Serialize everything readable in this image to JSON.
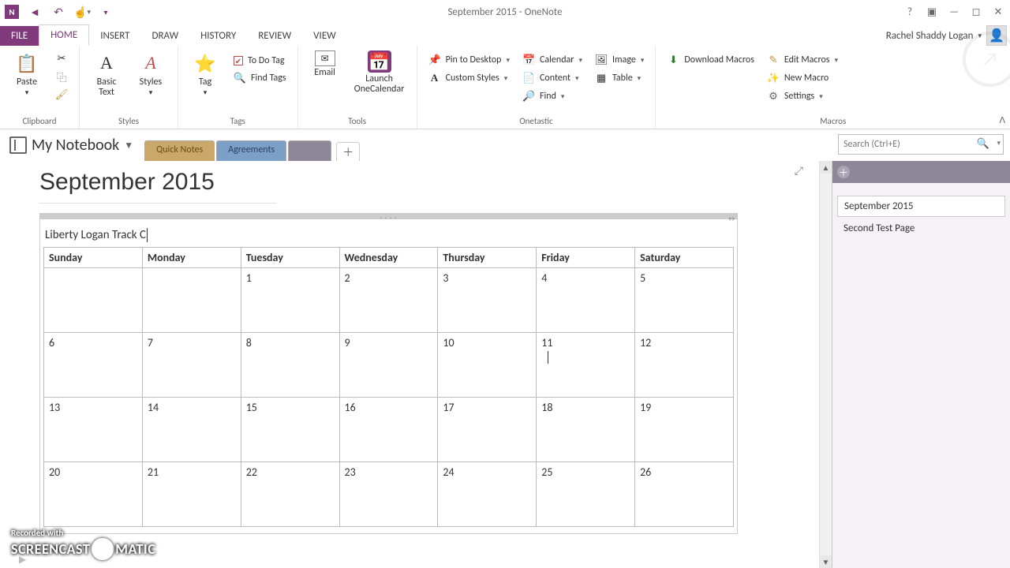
{
  "titlebar": {
    "title": "September 2015 - OneNote"
  },
  "file_tab": "FILE",
  "tabs": {
    "home": "HOME",
    "insert": "INSERT",
    "draw": "DRAW",
    "history": "HISTORY",
    "review": "REVIEW",
    "view": "VIEW"
  },
  "user": {
    "name": "Rachel Shaddy Logan"
  },
  "ribbon": {
    "clipboard": {
      "paste": "Paste",
      "label": "Clipboard"
    },
    "basictext": {
      "btn": "Basic\nText",
      "label": "Styles"
    },
    "styles_btn": "Styles",
    "tags": {
      "tag_btn": "Tag",
      "todo": "To Do Tag",
      "find": "Find Tags",
      "label": "Tags"
    },
    "tools": {
      "email": "Email",
      "launch": "Launch\nOneCalendar",
      "label": "Tools"
    },
    "onetastic": {
      "pin": "Pin to Desktop",
      "custom": "Custom Styles",
      "calendar": "Calendar",
      "content": "Content",
      "find": "Find",
      "image": "Image",
      "table": "Table",
      "label": "Onetastic"
    },
    "macros": {
      "download": "Download Macros",
      "edit": "Edit Macros",
      "new": "New Macro",
      "settings": "Settings",
      "label": "Macros"
    }
  },
  "notebook": {
    "name": "My Notebook",
    "tab1": "Quick Notes",
    "tab2": "Agreements",
    "tab3": " "
  },
  "search": {
    "placeholder": "Search (Ctrl+E)"
  },
  "page": {
    "title": "September 2015",
    "calendar_caption": "Liberty Logan Track C",
    "days": [
      "Sunday",
      "Monday",
      "Tuesday",
      "Wednesday",
      "Thursday",
      "Friday",
      "Saturday"
    ],
    "weeks": [
      [
        "",
        "",
        "1",
        "2",
        "3",
        "4",
        "5"
      ],
      [
        "6",
        "7",
        "8",
        "9",
        "10",
        "11",
        "12"
      ],
      [
        "13",
        "14",
        "15",
        "16",
        "17",
        "18",
        "19"
      ],
      [
        "20",
        "21",
        "22",
        "23",
        "24",
        "25",
        "26"
      ]
    ]
  },
  "pagelist": {
    "items": [
      "September 2015",
      "Second Test Page"
    ]
  },
  "watermark": {
    "rec": "Recorded with",
    "brand1": "SCREENCAST",
    "brand2": "MATIC"
  }
}
